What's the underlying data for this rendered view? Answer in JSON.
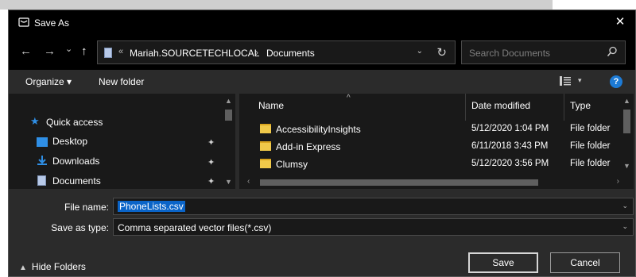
{
  "window": {
    "title": "Save As",
    "close_glyph": "✕"
  },
  "nav": {
    "back_glyph": "←",
    "forward_glyph": "→",
    "recent_glyph": "⌄",
    "up_glyph": "↑",
    "address": {
      "overflow_glyph": "«",
      "segments": [
        "Mariah.SOURCETECHLOCAL",
        "Documents"
      ],
      "separator": "›",
      "dropdown_glyph": "⌄",
      "refresh_glyph": "↻"
    },
    "search": {
      "placeholder": "Search Documents",
      "icon": "search-icon",
      "glyph": "⚲"
    }
  },
  "toolbar": {
    "organize_label": "Organize ▾",
    "new_folder_label": "New folder",
    "view_dropdown_glyph": "▾",
    "help_glyph": "?"
  },
  "nav_pane": {
    "items": [
      {
        "label": "Quick access",
        "icon": "star-icon",
        "pinned": false
      },
      {
        "label": "Desktop",
        "icon": "desktop-icon",
        "pinned": true
      },
      {
        "label": "Downloads",
        "icon": "download-icon",
        "pinned": true
      },
      {
        "label": "Documents",
        "icon": "documents-icon",
        "pinned": true
      }
    ],
    "pin_glyph": "📌"
  },
  "file_list": {
    "columns": {
      "name": "Name",
      "date": "Date modified",
      "type": "Type"
    },
    "sort_glyph": "^",
    "rows": [
      {
        "name": "AccessibilityInsights",
        "date": "5/12/2020 1:04 PM",
        "type": "File folder"
      },
      {
        "name": "Add-in Express",
        "date": "6/11/2018 3:43 PM",
        "type": "File folder"
      },
      {
        "name": "Clumsy",
        "date": "5/12/2020 3:56 PM",
        "type": "File folder"
      }
    ]
  },
  "form": {
    "file_name_label": "File name:",
    "file_name_value": "PhoneLists.csv",
    "save_type_label": "Save as type:",
    "save_type_value": "Comma separated vector files(*.csv)"
  },
  "footer": {
    "hide_folders_label": "Hide Folders",
    "save_label": "Save",
    "cancel_label": "Cancel"
  },
  "colors": {
    "dialog_bg": "#2b2b2b",
    "titlebar_bg": "#000000",
    "pane_bg": "#191919",
    "selection": "#0a64c8",
    "folder": "#f0c94a",
    "accent_blue": "#1d7bd6"
  }
}
